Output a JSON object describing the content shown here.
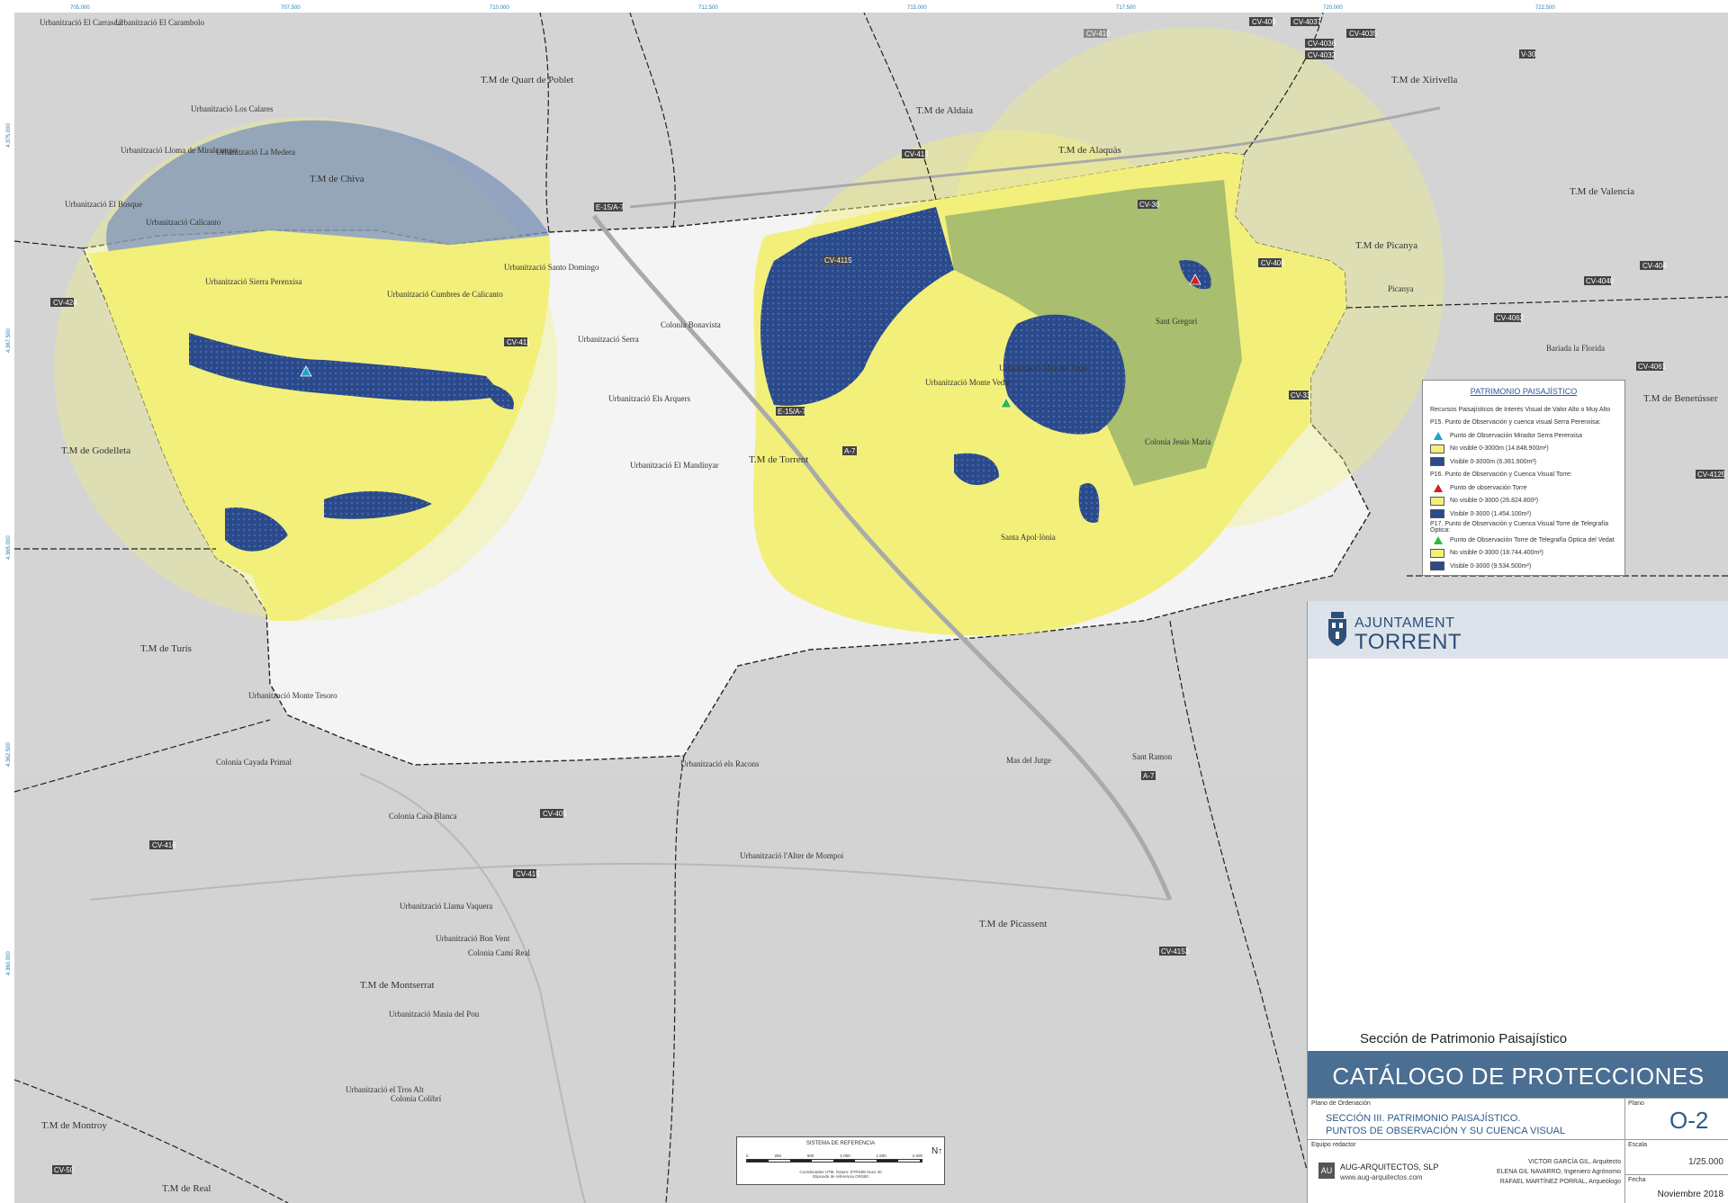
{
  "map": {
    "municipalities": [
      "T.M de Quart de Poblet",
      "T.M de Aldaia",
      "T.M de Alaquàs",
      "T.M de Xirivella",
      "T.M de Valencia",
      "T.M de Picanya",
      "T.M de Torrent",
      "T.M de Godelleta",
      "T.M de Turís",
      "T.M de Montserrat",
      "T.M de Picassent",
      "T.M de Benetússer",
      "T.M de Montroy",
      "T.M de Real",
      "T.M de Chiva"
    ],
    "roads": [
      "CV-409",
      "CV-4037",
      "CV-4036",
      "CV-4032",
      "CV-4035",
      "CV-410",
      "V-30",
      "CV-413",
      "E-15/A-7",
      "CV-36",
      "CV-4115",
      "CV-406",
      "CV-404",
      "CV-4040",
      "CV-4062",
      "CV-424",
      "CV-411",
      "E-15/A-7",
      "A-7",
      "CV-33",
      "CV-4061",
      "CV-4125",
      "A-7",
      "CV-405",
      "CV-415",
      "CV-416",
      "CV-4153",
      "CV-50"
    ],
    "places": [
      "Urbanització El Carrascal",
      "Urbanització El Carambolo",
      "Urbanització Los Calares",
      "Urbanització Lloma de Miralcampo",
      "Urbanització La Medera",
      "Urbanització Calicanto",
      "Urbanització El Bosque",
      "Urbanització Sierra Perenxisa",
      "Urbanització Cumbres de Calicanto",
      "Urbanització Santo Domingo",
      "Colonia Bonavista",
      "Urbanització Serra",
      "Urbanització Els Arquers",
      "Urbanització El Mandinyar",
      "Urbanització Monte Vedat",
      "Urbanització Mas del Jutge",
      "Santa Apol·lònia",
      "Colonia Jesús María",
      "Sant Gregori",
      "Picanya",
      "Bariada la Florida",
      "Urbanització Monte Tesoro",
      "Colonia Cayada Primal",
      "Colonia Casa Blanca",
      "Urbanització l'Alter de Mompoi",
      "Urbanització els Racons",
      "Urbanització Masia del Pou",
      "Urbanització el Tros Alt",
      "Urbanització Llama Vaquera",
      "Mas del Jutge",
      "Colonia Camí Real",
      "Sant Ramon",
      "Urbanització Bon Vent",
      "Colonia Colibrí"
    ]
  },
  "legend": {
    "title": "PATRIMONIO PAISAJÍSTICO",
    "subtitle": "Recursos Paisajísticos de Interés Visual de Valor Alto o Muy Alto",
    "p15": "P15. Punto de Observación y cuenca visual Serra Perenxisa:",
    "p15_point": "Punto de Observación Mirador Serra Perenxisa",
    "p15_nv": "No visible 0-3000m (14.848.900m²)",
    "p15_v": "Visible 0-3000m (6.361.900m²)",
    "p16": "P16. Punto de Observación y Cuenca Visual Torre:",
    "p16_point": "Punto de observación Torre",
    "p16_nv": "No visible 0-3000 (26.824.800²)",
    "p16_v": "Visible 0-3000 (1.454.100m²)",
    "p17": "P17. Punto de Observación y Cuenca Visual Torre de Telegrafía Óptica:",
    "p17_point": "Punto de Observación Torre de Telegrafía Óptica del Vedat",
    "p17_nv": "No visible 0-3000 (18.744.400m²)",
    "p17_v": "Visible 0-3000 (9.534.500m²)",
    "colors": {
      "visible": "#2b4a8c",
      "no_visible": "#f2f07a",
      "p15": "#1aa6c8",
      "p16": "#d42020",
      "p17": "#2dbb3f"
    }
  },
  "title_block": {
    "ajuntament": "AJUNTAMENT",
    "torrent": "TORRENT",
    "section": "Sección de Patrimonio Paisajístico",
    "catalog": "CATÁLOGO DE PROTECCIONES",
    "plano_label": "Plano de Ordenación",
    "plano_title_1": "SECCIÓN III. PATRIMONIO PAISAJÍSTICO.",
    "plano_title_2": "PUNTOS DE OBSERVACIÓN Y SU CUENCA VISUAL",
    "plano_num_label": "Plano",
    "plano_num": "O-2",
    "escala_label": "Escala",
    "escala": "1/25.000",
    "equipo_label": "Equipo redactor",
    "firm": "AUG-ARQUITECTOS, SLP",
    "web": "www.aug-arquitectos.com",
    "author_1": "VICTOR GARCÍA GIL, Arquitecto",
    "author_2": "ELENA GIL NAVARRO, Ingeniero Agrónomo",
    "author_3": "RAFAEL MARTÍNEZ PORRAL, Arqueólogo",
    "fecha_label": "Fecha",
    "fecha": "Noviembre 2018"
  },
  "scale": {
    "title": "SISTEMA DE REFERENCIA",
    "ticks": [
      "0",
      "250",
      "500",
      "1.000",
      "1.500",
      "2.000"
    ],
    "north": "N",
    "note_1": "Coordenadas UTM. Datum: ETRS89 Huso 30",
    "note_2": "Elipsoide de referencia GRS80"
  },
  "coords": {
    "top": [
      "705.000",
      "707.500",
      "710.000",
      "712.500",
      "715.000",
      "717.500",
      "720.000",
      "722.500"
    ],
    "left": [
      "4.375.000",
      "4.367.500",
      "4.365.000",
      "4.362.500",
      "4.360.000"
    ]
  }
}
